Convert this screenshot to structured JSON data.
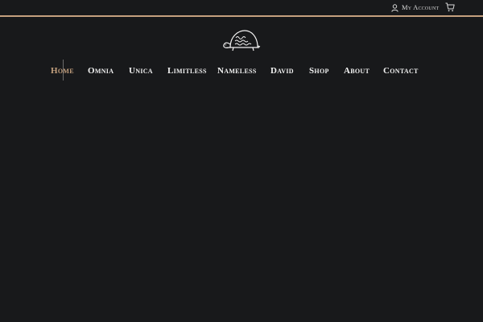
{
  "header": {
    "account_label": "My Account",
    "account_icon": "user-icon",
    "cart_icon": "cart-icon",
    "accent_color": "#c4a07e",
    "background_color": "#18191b"
  },
  "logo": {
    "icon": "turtle-logo-icon"
  },
  "nav": {
    "items": [
      {
        "label": "Home",
        "active": true
      },
      {
        "label": "Omnia",
        "active": false
      },
      {
        "label": "Unica",
        "active": false
      },
      {
        "label": "Limitless",
        "active": false
      },
      {
        "label": "Nameless",
        "active": false
      },
      {
        "label": "David",
        "active": false
      },
      {
        "label": "Shop",
        "active": false
      },
      {
        "label": "About",
        "active": false
      },
      {
        "label": "Contact",
        "active": false
      }
    ]
  }
}
